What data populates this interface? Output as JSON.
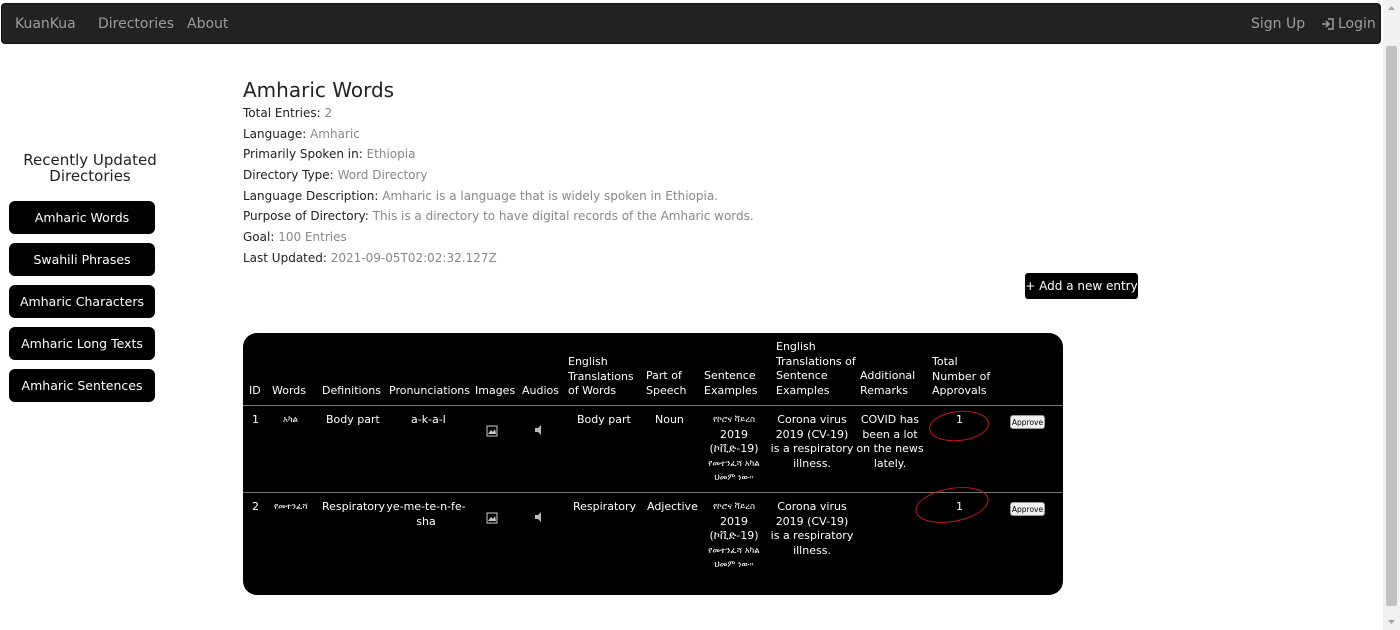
{
  "navbar": {
    "brand": "KuanKua",
    "directories": "Directories",
    "about": "About",
    "signup": "Sign Up",
    "login": "Login"
  },
  "sidebar": {
    "title": "Recently Updated Directories",
    "items": [
      "Amharic Words",
      "Swahili Phrases",
      "Amharic Characters",
      "Amharic Long Texts",
      "Amharic Sentences"
    ]
  },
  "directory": {
    "title": "Amharic Words",
    "fields": [
      {
        "label": "Total Entries:",
        "value": "2"
      },
      {
        "label": "Language:",
        "value": "Amharic"
      },
      {
        "label": "Primarily Spoken in:",
        "value": "Ethiopia"
      },
      {
        "label": "Directory Type:",
        "value": "Word Directory"
      },
      {
        "label": "Language Description:",
        "value": "Amharic is a language that is widely spoken in Ethiopia."
      },
      {
        "label": "Purpose of Directory:",
        "value": "This is a directory to have digital records of the Amharic words."
      },
      {
        "label": "Goal:",
        "value": "100 Entries"
      },
      {
        "label": "Last Updated:",
        "value": "2021-09-05T02:02:32.127Z"
      }
    ],
    "add_entry_label": "+ Add a new entry"
  },
  "table": {
    "headers": {
      "id": "ID",
      "words": "Words",
      "definitions": "Definitions",
      "pronunciations": "Pronunciations",
      "images": "Images",
      "audios": "Audios",
      "english_translations": [
        "English",
        "Translations",
        "of Words"
      ],
      "part_of_speech": [
        "Part of",
        "Speech"
      ],
      "sentence_examples": [
        "Sentence",
        "Examples"
      ],
      "english_sentence_translations": [
        "English",
        "Translations of",
        "Sentence",
        "Examples"
      ],
      "additional_remarks": [
        "Additional",
        "Remarks"
      ],
      "total_approvals": [
        "Total",
        "Number of",
        "Approvals"
      ]
    },
    "rows": [
      {
        "id": "1",
        "word": "አካል",
        "definition": "Body part",
        "pronunciation": "a-k-a-l",
        "translation": "Body part",
        "part_of_speech": "Noun",
        "sentence_example": [
          "የኮሮና ቫይረስ",
          "2019",
          "(ኮቪድ-19)",
          "የመተንፈሻ አካል",
          "ህመም ነው።"
        ],
        "sentence_translation": [
          "Corona virus",
          "2019 (CV-19)",
          "is a respiratory",
          "illness."
        ],
        "remarks": [
          "COVID has",
          "been a lot",
          "on the news",
          "lately."
        ],
        "approvals": "1",
        "approve_label": "Approve"
      },
      {
        "id": "2",
        "word": "የመተንፈሻ",
        "definition": "Respiratory",
        "pronunciation": [
          "ye-me-te-n-fe-",
          "sha"
        ],
        "translation": "Respiratory",
        "part_of_speech": "Adjective",
        "sentence_example": [
          "የኮሮና ቫይረስ",
          "2019",
          "(ኮቪድ-19)",
          "የመተንፈሻ አካል",
          "ህመም ነው።"
        ],
        "sentence_translation": [
          "Corona virus",
          "2019 (CV-19)",
          "is a respiratory",
          "illness."
        ],
        "remarks": [],
        "approvals": "1",
        "approve_label": "Approve"
      }
    ]
  },
  "colors": {
    "navbar_bg": "#222222",
    "nav_text": "#9d9d9d",
    "button_bg": "#000000",
    "annotation_red": "#c4161c"
  },
  "icons": {
    "login": "login-icon",
    "image": "image-icon",
    "audio": "speaker-icon"
  }
}
